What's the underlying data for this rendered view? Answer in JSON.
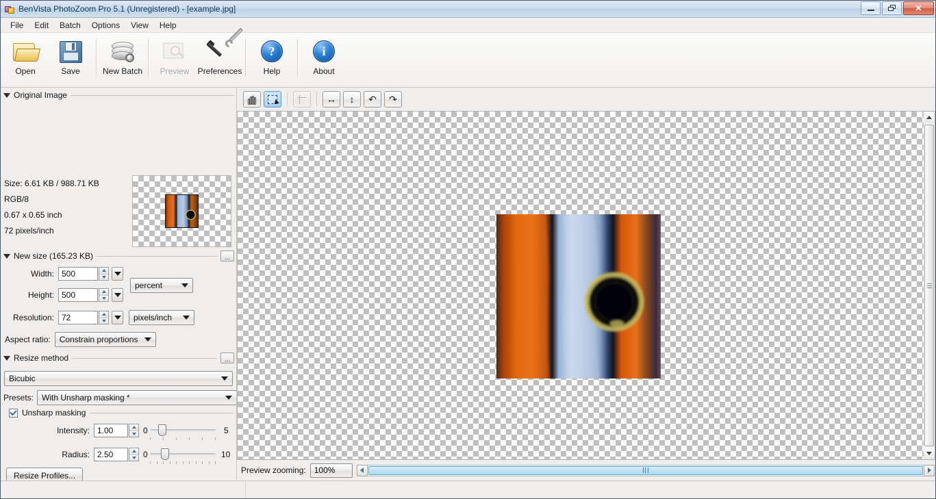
{
  "window": {
    "title": "BenVista PhotoZoom Pro 5.1 (Unregistered) - [example.jpg]",
    "icon": "photozoom-logo-icon",
    "controls": {
      "minimize": "minimize-icon",
      "restore": "restore-icon",
      "close": "close-icon"
    }
  },
  "menubar": {
    "items": [
      {
        "label": "File"
      },
      {
        "label": "Edit"
      },
      {
        "label": "Batch"
      },
      {
        "label": "Options"
      },
      {
        "label": "View"
      },
      {
        "label": "Help"
      }
    ]
  },
  "toolbar": {
    "buttons": [
      {
        "label": "Open",
        "icon": "folder-open-icon",
        "disabled": false
      },
      {
        "label": "Save",
        "icon": "floppy-disk-icon",
        "disabled": false
      },
      {
        "label": "New Batch",
        "icon": "batch-discs-icon",
        "disabled": false
      },
      {
        "label": "Preview",
        "icon": "preview-magnifier-icon",
        "disabled": true
      },
      {
        "label": "Preferences",
        "icon": "hammer-wrench-icon",
        "disabled": false
      },
      {
        "label": "Help",
        "icon": "question-mark-icon",
        "disabled": false
      },
      {
        "label": "About",
        "icon": "info-icon",
        "disabled": false
      }
    ],
    "help_glyph": "?",
    "about_glyph": "i"
  },
  "sidebar": {
    "original_image": {
      "title": "Original Image",
      "size": "Size: 6.61 KB / 988.71 KB",
      "color_mode": "RGB/8",
      "dimensions": "0.67 x 0.65 inch",
      "resolution": "72 pixels/inch"
    },
    "new_size": {
      "title": "New size (165.23 KB)",
      "options_button": "...",
      "width_label": "Width:",
      "width_value": "500",
      "height_label": "Height:",
      "height_value": "500",
      "size_unit": "percent",
      "resolution_label": "Resolution:",
      "resolution_value": "72",
      "resolution_unit": "pixels/inch",
      "aspect_label": "Aspect ratio:",
      "aspect_value": "Constrain proportions"
    },
    "resize_method": {
      "title": "Resize method",
      "options_button": "...",
      "method": "Bicubic",
      "presets_label": "Presets:",
      "preset_value": "With Unsharp masking *",
      "unsharp_label": "Unsharp masking",
      "unsharp_checked": true,
      "intensity_label": "Intensity:",
      "intensity_value": "1.00",
      "intensity_min": "0",
      "intensity_max": "5",
      "radius_label": "Radius:",
      "radius_value": "2.50",
      "radius_min": "0",
      "radius_max": "10",
      "profiles_button": "Resize Profiles..."
    }
  },
  "image_toolbar": {
    "buttons": [
      {
        "name": "pan-tool",
        "icon": "hand-icon",
        "active": false,
        "disabled": false
      },
      {
        "name": "select-tool",
        "icon": "marquee-select-icon",
        "active": true,
        "disabled": false
      },
      {
        "name": "crop-tool",
        "icon": "crop-icon",
        "active": false,
        "disabled": true
      },
      {
        "name": "flip-horizontal",
        "icon": "flip-horizontal-icon",
        "glyph": "↔",
        "active": false,
        "disabled": false
      },
      {
        "name": "flip-vertical",
        "icon": "flip-vertical-icon",
        "glyph": "↕",
        "active": false,
        "disabled": false
      },
      {
        "name": "rotate-left",
        "icon": "rotate-left-icon",
        "glyph": "↶",
        "active": false,
        "disabled": false
      },
      {
        "name": "rotate-right",
        "icon": "rotate-right-icon",
        "glyph": "↷",
        "active": false,
        "disabled": false
      }
    ]
  },
  "zoombar": {
    "label": "Preview zooming:",
    "zoom_value": "100%"
  },
  "statusbar": {
    "left_text": "",
    "right_text": ""
  }
}
